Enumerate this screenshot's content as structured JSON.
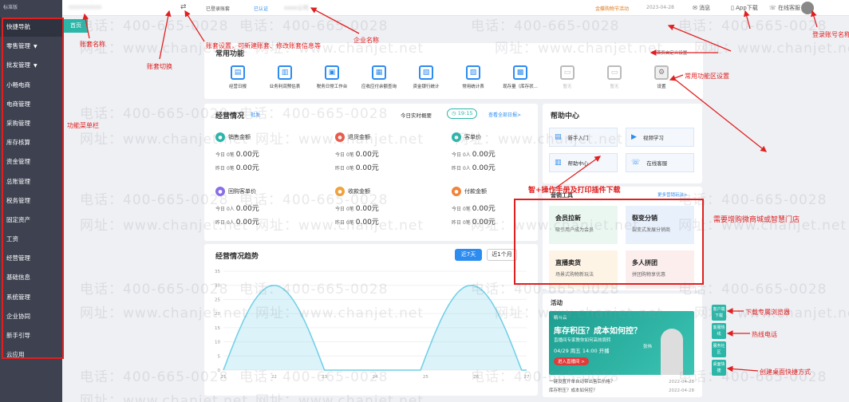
{
  "sidebar": {
    "logo": "标准版",
    "items": [
      {
        "label": "快捷导航",
        "arrow": false
      },
      {
        "label": "零售管理",
        "arrow": true
      },
      {
        "label": "批发管理",
        "arrow": true
      },
      {
        "label": "小畅电商",
        "arrow": false
      },
      {
        "label": "电商管理",
        "arrow": false
      },
      {
        "label": "采购管理",
        "arrow": false
      },
      {
        "label": "库存核算",
        "arrow": false
      },
      {
        "label": "资金管理",
        "arrow": false
      },
      {
        "label": "总账管理",
        "arrow": false
      },
      {
        "label": "税务管理",
        "arrow": false
      },
      {
        "label": "固定资产",
        "arrow": false
      },
      {
        "label": "工资",
        "arrow": false
      },
      {
        "label": "经营管理",
        "arrow": false
      },
      {
        "label": "基础信息",
        "arrow": false
      },
      {
        "label": "系统管理",
        "arrow": false
      },
      {
        "label": "企业协同",
        "arrow": false
      },
      {
        "label": "新手引导",
        "arrow": false
      },
      {
        "label": "云应用",
        "arrow": false
      }
    ]
  },
  "topbar": {
    "account_name": "xxxxxxxxxx",
    "switch_icon": "switch-icon",
    "status_a": "已登录账套",
    "status_b": "已认证",
    "company": "xxxx公司",
    "right_a": "金蝶购物节活动",
    "right_b": "2023-04-28",
    "right_c": "消息",
    "right_d": "App下载",
    "right_e": "在线客服"
  },
  "tab_home": "首页",
  "common": {
    "title": "常用功能",
    "settings_link": "首页自定义设置",
    "functions": [
      {
        "label": "经营日报",
        "icon": "report-icon",
        "disabled": false
      },
      {
        "label": "业务利润预估表",
        "icon": "profit-icon",
        "disabled": false
      },
      {
        "label": "税务日常工作台",
        "icon": "tax-icon",
        "disabled": false
      },
      {
        "label": "应收应付余额查询",
        "icon": "balance-icon",
        "disabled": false
      },
      {
        "label": "资金银行统计",
        "icon": "bank-icon",
        "disabled": false
      },
      {
        "label": "常用统计表",
        "icon": "stats-icon",
        "disabled": false
      },
      {
        "label": "现存量（库存状...",
        "icon": "stock-icon",
        "disabled": false
      },
      {
        "label": "暂无",
        "icon": "empty-icon",
        "disabled": true
      },
      {
        "label": "暂无",
        "icon": "empty-icon",
        "disabled": true
      },
      {
        "label": "设置",
        "icon": "gear-icon",
        "disabled": false
      }
    ]
  },
  "business": {
    "title": "经营情况",
    "badge": "批发",
    "realtime": "今日实时概要",
    "time": "19:15",
    "view_all": "查看全部日报>",
    "metrics": [
      {
        "name": "销售金额",
        "color": "#2bb6a8",
        "today_label": "今日",
        "today_count": "0笔",
        "today_value": "0.00元",
        "yesterday_label": "昨日",
        "yesterday_count": "0笔",
        "yesterday_value": "0.00元"
      },
      {
        "name": "退货金额",
        "color": "#ea5a4a",
        "today_label": "今日",
        "today_count": "0笔",
        "today_value": "0.00元",
        "yesterday_label": "昨日",
        "yesterday_count": "0笔",
        "yesterday_value": "0.00元"
      },
      {
        "name": "客单价",
        "color": "#2bb6a8",
        "today_label": "今日",
        "today_count": "0人",
        "today_value": "0.00元",
        "yesterday_label": "昨日",
        "yesterday_count": "0人",
        "yesterday_value": "0.00元"
      },
      {
        "name": "回购客单价",
        "color": "#8a6de9",
        "today_label": "今日",
        "today_count": "0人",
        "today_value": "0.00元",
        "yesterday_label": "昨日",
        "yesterday_count": "0人",
        "yesterday_value": "0.00元"
      },
      {
        "name": "收款金额",
        "color": "#f1a23a",
        "today_label": "今日",
        "today_count": "0笔",
        "today_value": "0.00元",
        "yesterday_label": "昨日",
        "yesterday_count": "0笔",
        "yesterday_value": "0.00元"
      },
      {
        "name": "付款金额",
        "color": "#f1843a",
        "today_label": "今日",
        "today_count": "0笔",
        "today_value": "0.00元",
        "yesterday_label": "昨日",
        "yesterday_count": "0笔",
        "yesterday_value": "0.00元"
      }
    ]
  },
  "trend": {
    "title": "经营情况趋势",
    "btn_7": "近7天",
    "btn_30": "近1个月"
  },
  "chart_data": {
    "type": "area",
    "x": [
      "21",
      "22",
      "23",
      "24",
      "25",
      "26",
      "27"
    ],
    "ylim": [
      0,
      35
    ],
    "yticks": [
      "35",
      "30",
      "25",
      "20",
      "15",
      "10",
      "5",
      "0"
    ],
    "peaks": [
      30,
      30
    ],
    "color": "#6fcfe6"
  },
  "help": {
    "title": "帮助中心",
    "items": [
      {
        "label": "新手入门",
        "icon": "clipboard-icon"
      },
      {
        "label": "视频学习",
        "icon": "video-icon"
      },
      {
        "label": "帮助中心",
        "icon": "document-icon"
      },
      {
        "label": "在线客服",
        "icon": "headset-icon"
      }
    ]
  },
  "promo": {
    "title": "营销工具",
    "more": "更多营销玩法>",
    "items": [
      {
        "title": "会员拉新",
        "sub": "吸引用户成为会员",
        "bg": "#eaf7f1"
      },
      {
        "title": "裂变分销",
        "sub": "裂变式发展分销商",
        "bg": "#e8f0fb"
      },
      {
        "title": "直播卖货",
        "sub": "场景式购物新玩法",
        "bg": "#fdf4e6"
      },
      {
        "title": "多人拼团",
        "sub": "拼团购物享优惠",
        "bg": "#fdeeee"
      }
    ]
  },
  "activity": {
    "title": "活动",
    "banner_brand": "精斗云",
    "banner_headline": "库存积压？成本如何控？",
    "banner_sub": "直播间专家教你如何高效周转",
    "banner_date": "04/29 周五 14:00 开播",
    "banner_btn": "进入直播间 >",
    "banner_speaker": "张伟",
    "news": [
      {
        "text": "一键设置开单自动带出售后价格？",
        "date": "2022-04-28"
      },
      {
        "text": "库存积压？成本如何控？",
        "date": "2022-04-28"
      }
    ]
  },
  "right_buttons": [
    {
      "label": "客户端下载",
      "icon": "download-icon"
    },
    {
      "label": "客服热线",
      "icon": "phone-icon"
    },
    {
      "label": "服务社区",
      "icon": "community-icon"
    },
    {
      "label": "桌面快捷",
      "icon": "desktop-icon"
    }
  ],
  "watermark": {
    "phone": "电话：400-665-0028",
    "site": "网址：www.chanjet.net"
  },
  "annotations": {
    "a1": "账套名称",
    "a2": "账套切换",
    "a3": "账套设置，可新建账套、修改账套信息等",
    "a4": "企业名称",
    "a5": "登录账号名称",
    "a6": "常用功能区设置",
    "a7": "功能菜单栏",
    "a8": "智+操作手册及打印插件下载",
    "a9": "需要增购微商城或智慧门店",
    "a10": "下载专属浏览器",
    "a11": "热线电话",
    "a12": "创建桌面快捷方式"
  }
}
